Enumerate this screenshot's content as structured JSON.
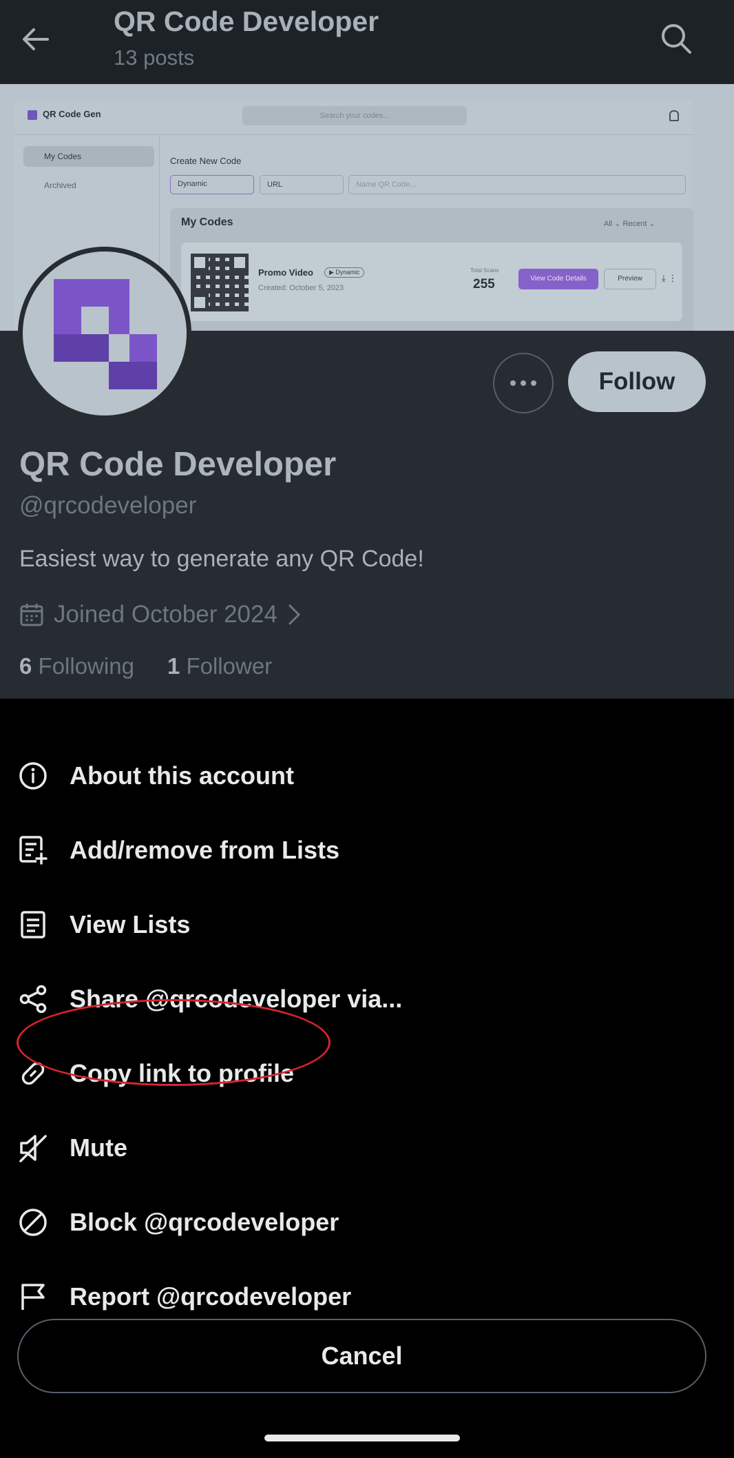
{
  "header": {
    "title": "QR Code Developer",
    "subtitle": "13 posts"
  },
  "banner": {
    "brand": "QR Code Gen",
    "search_placeholder": "Search your codes...",
    "nav": [
      "My Codes",
      "Archived"
    ],
    "create_label": "Create New Code",
    "type_select": "Dynamic",
    "content_select": "URL",
    "name_placeholder": "Name QR Code...",
    "section_title": "My Codes",
    "filters": "All ⌄   Recent ⌄",
    "card": {
      "name": "Promo Video",
      "badge": "▶ Dynamic",
      "created": "Created: October 5, 2023",
      "scans_label": "Total Scans",
      "scans_value": "255",
      "view_label": "View Code Details",
      "preview_label": "Preview"
    }
  },
  "profile": {
    "name": "QR Code Developer",
    "handle": "@qrcodeveloper",
    "bio": "Easiest way to generate any QR Code!",
    "joined": "Joined October 2024",
    "following_count": "6",
    "following_label": "Following",
    "followers_count": "1",
    "followers_label": "Follower",
    "follow_label": "Follow"
  },
  "menu": {
    "items": [
      {
        "label": "About this account",
        "icon": "info-icon"
      },
      {
        "label": "Add/remove from Lists",
        "icon": "list-add-icon"
      },
      {
        "label": "View Lists",
        "icon": "list-icon"
      },
      {
        "label": "Share @qrcodeveloper via...",
        "icon": "share-icon"
      },
      {
        "label": "Copy link to profile",
        "icon": "link-icon"
      },
      {
        "label": "Mute",
        "icon": "mute-icon"
      },
      {
        "label": "Block @qrcodeveloper",
        "icon": "block-icon"
      },
      {
        "label": "Report @qrcodeveloper",
        "icon": "flag-icon"
      }
    ],
    "cancel_label": "Cancel",
    "highlighted_item": "Copy link to profile",
    "highlight_color": "#d8232f"
  }
}
